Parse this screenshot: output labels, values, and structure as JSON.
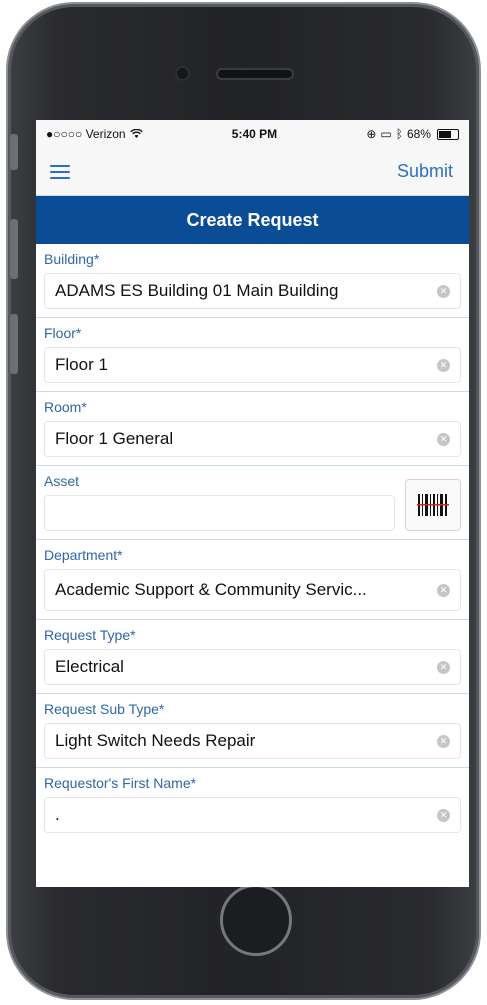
{
  "status_bar": {
    "carrier": "●○○○○ Verizon",
    "time": "5:40 PM",
    "battery": "68%"
  },
  "nav": {
    "submit_label": "Submit"
  },
  "header": {
    "title": "Create Request"
  },
  "fields": [
    {
      "label": "Building*",
      "value": "ADAMS ES Building 01 Main Building"
    },
    {
      "label": "Floor*",
      "value": "Floor 1"
    },
    {
      "label": "Room*",
      "value": "Floor 1 General"
    },
    {
      "label": "Asset",
      "value": ""
    },
    {
      "label": "Department*",
      "value": "Academic Support & Community Servic..."
    },
    {
      "label": "Request Type*",
      "value": "Electrical"
    },
    {
      "label": "Request Sub Type*",
      "value": "Light Switch Needs Repair"
    },
    {
      "label": "Requestor's First Name*",
      "value": "."
    }
  ],
  "colors": {
    "header_bg": "#0a4d96",
    "accent": "#2e6fc1",
    "label": "#2f66a9"
  }
}
